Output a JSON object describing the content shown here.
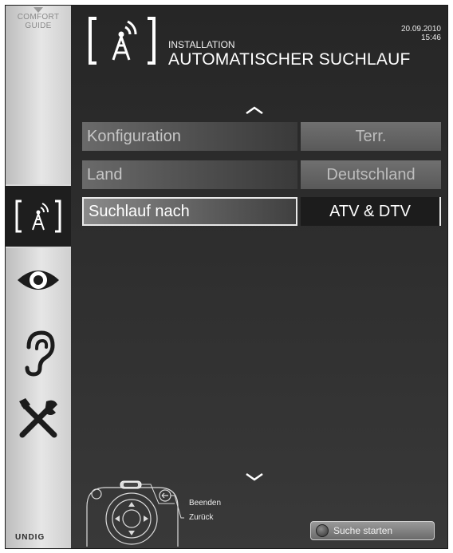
{
  "sidebar": {
    "comfort_guide_line1": "COMFORT",
    "comfort_guide_line2": "GUIDE",
    "brand": "UNDIG",
    "icons": [
      "installation-antenna-icon",
      "eye-icon",
      "ear-icon",
      "tools-icon"
    ],
    "active_index": 0
  },
  "header": {
    "section": "INSTALLATION",
    "title": "AUTOMATISCHER SUCHLAUF",
    "date": "20.09.2010",
    "time": "15:46"
  },
  "menu": {
    "rows": [
      {
        "label": "Konfiguration",
        "value": "Terr."
      },
      {
        "label": "Land",
        "value": "Deutschland"
      },
      {
        "label": "Suchlauf nach",
        "value": "ATV & DTV"
      }
    ],
    "selected_index": 2
  },
  "footer": {
    "legend_exit": "Beenden",
    "legend_back": "Zurück",
    "start_button": "Suche starten"
  }
}
